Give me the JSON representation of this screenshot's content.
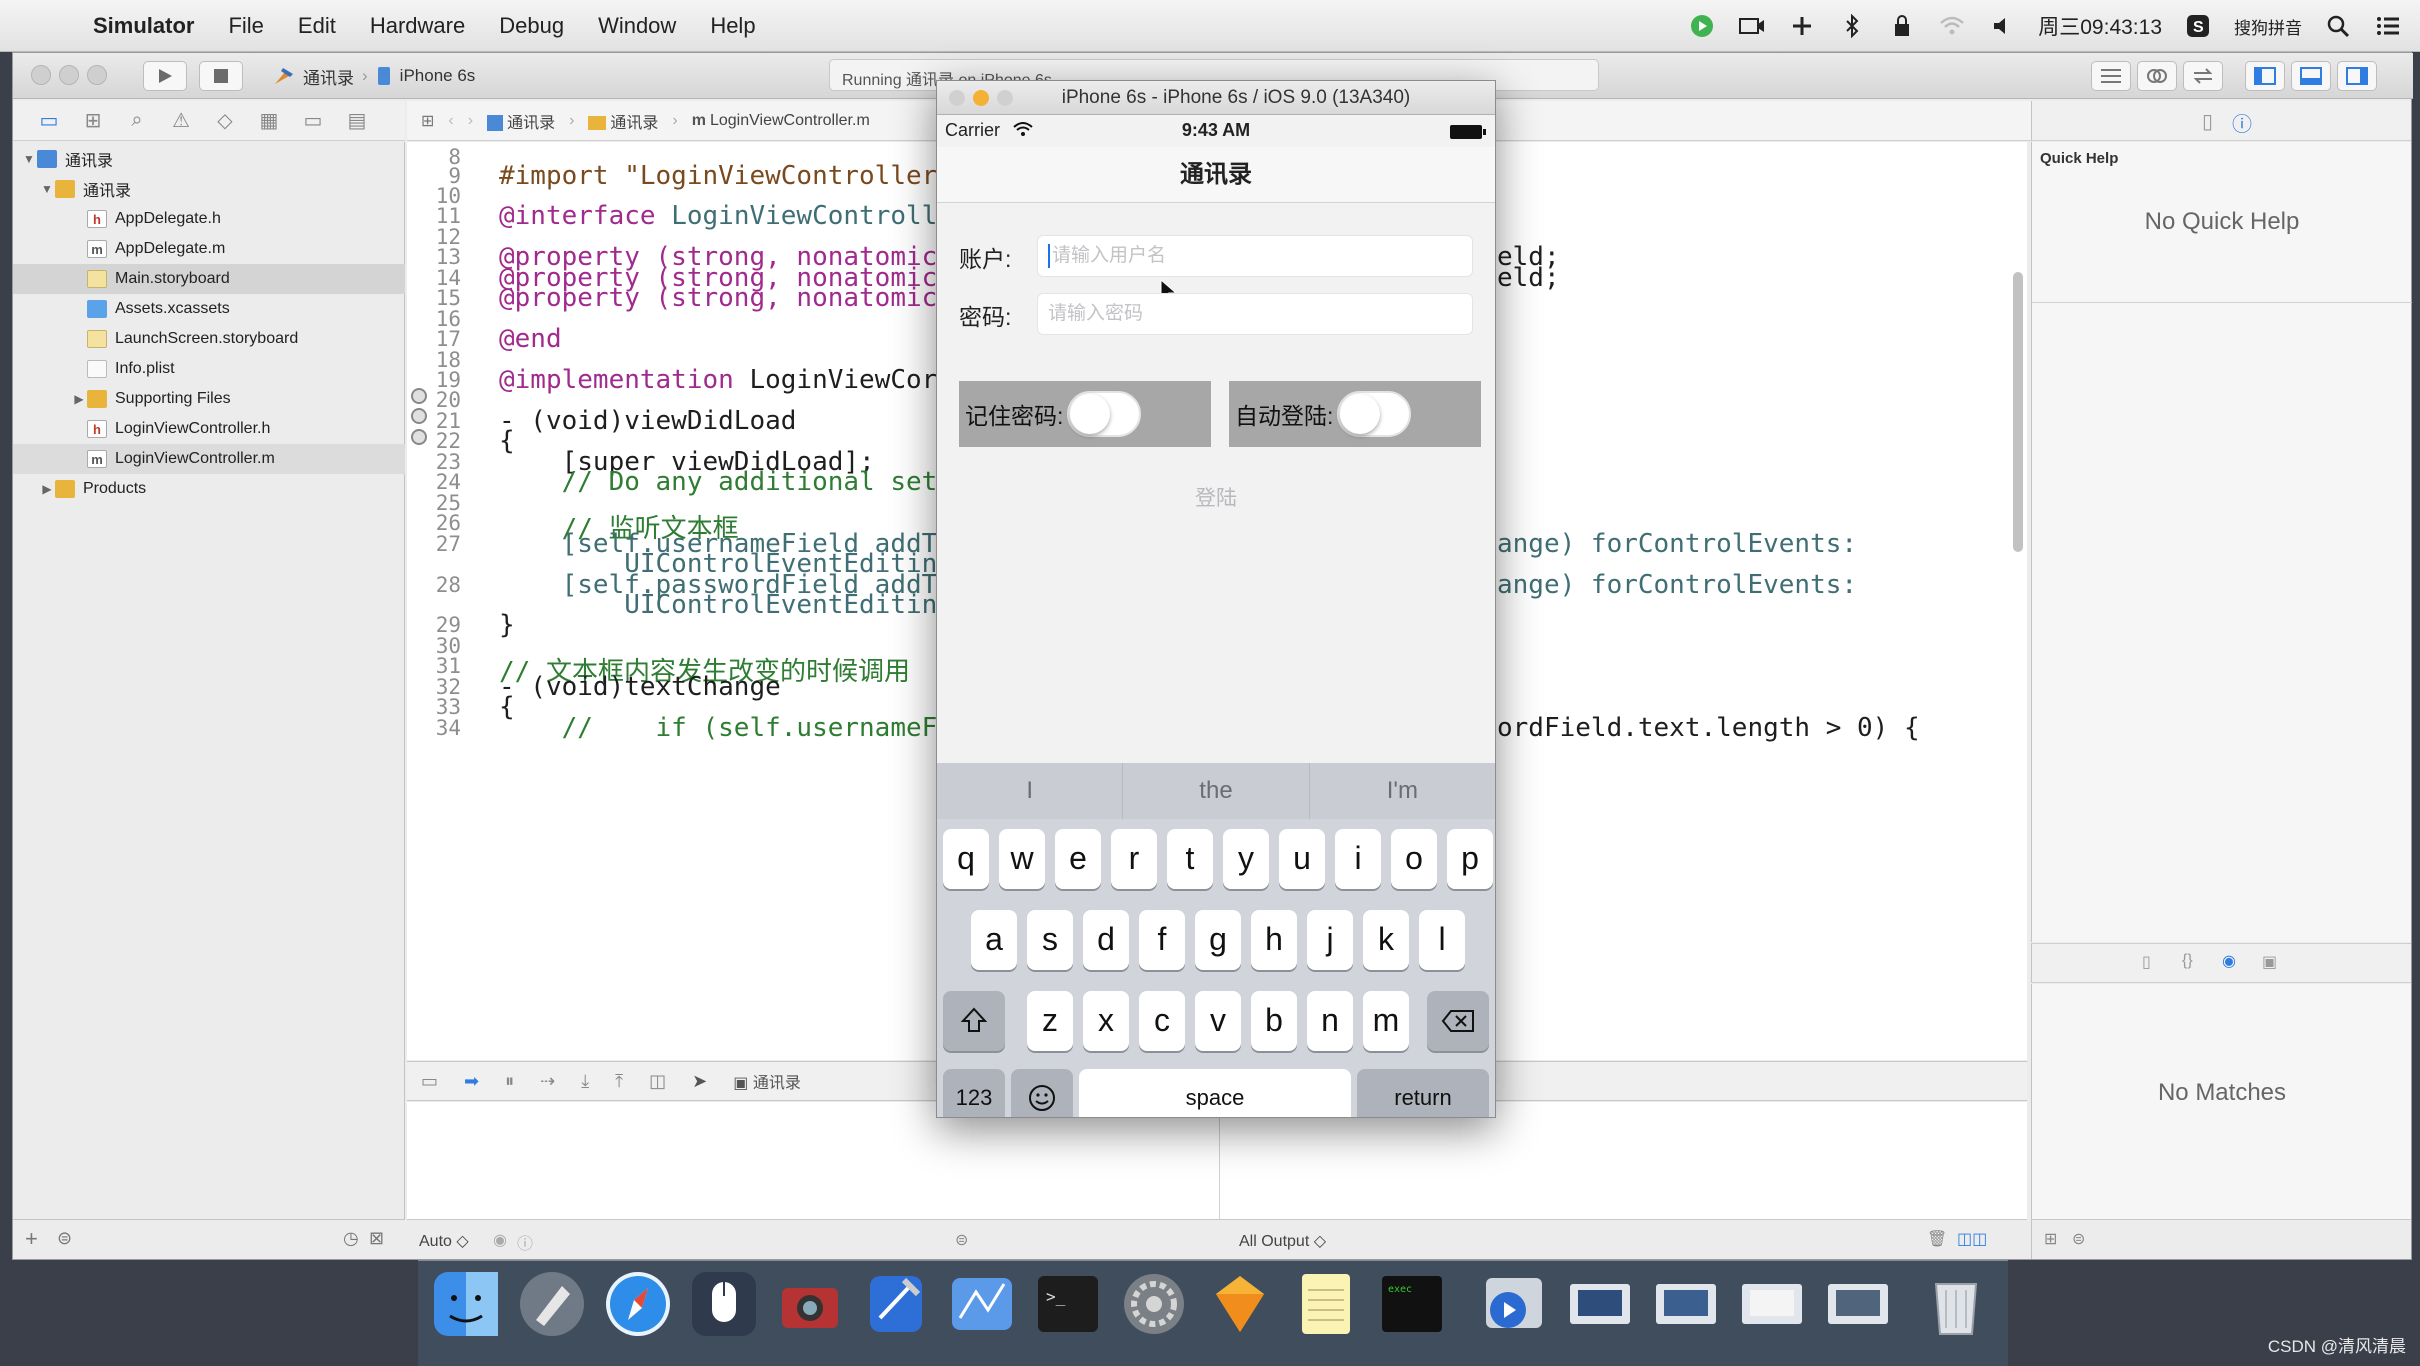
{
  "menubar": {
    "apple": "",
    "items": [
      "Simulator",
      "File",
      "Edit",
      "Hardware",
      "Debug",
      "Window",
      "Help"
    ],
    "clock": "周三09:43:13",
    "ime": "搜狗拼音"
  },
  "toolbar": {
    "scheme_project": "通讯录",
    "scheme_device": "iPhone 6s",
    "activity": "Running 通讯录 on iPhone 6s"
  },
  "navigator": {
    "items": [
      {
        "label": "通讯录",
        "type": "project"
      },
      {
        "label": "通讯录",
        "type": "folder"
      },
      {
        "label": "AppDelegate.h",
        "type": "h"
      },
      {
        "label": "AppDelegate.m",
        "type": "m"
      },
      {
        "label": "Main.storyboard",
        "type": "storyboard"
      },
      {
        "label": "Assets.xcassets",
        "type": "assets"
      },
      {
        "label": "LaunchScreen.storyboard",
        "type": "storyboard"
      },
      {
        "label": "Info.plist",
        "type": "plist"
      },
      {
        "label": "Supporting Files",
        "type": "folder"
      },
      {
        "label": "LoginViewController.h",
        "type": "h"
      },
      {
        "label": "LoginViewController.m",
        "type": "m"
      },
      {
        "label": "Products",
        "type": "folder"
      }
    ]
  },
  "jumpbar": {
    "crumbs": [
      "通讯录",
      "通讯录",
      "LoginViewController.m"
    ]
  },
  "editor": {
    "line_numbers": [
      "8",
      "9",
      "10",
      "11",
      "12",
      "13",
      "14",
      "15",
      "16",
      "17",
      "18",
      "19",
      "20",
      "21",
      "22",
      "23",
      "24",
      "25",
      "26",
      "27",
      "",
      "28",
      "",
      "29",
      "30",
      "31",
      "32",
      "33",
      "34"
    ],
    "lines": {
      "l9": "#import \"LoginViewController",
      "l11a": "@interface",
      "l11b": " LoginViewControll",
      "l13": "@property (strong, nonatomic",
      "l14": "@property (strong, nonatomic",
      "l15": "@property (strong, nonatomic",
      "l17": "@end",
      "l19a": "@implementation",
      "l19b": " LoginViewCor",
      "l21": "- (void)viewDidLoad",
      "l22": "{",
      "l23": "    [super viewDidLoad];",
      "l24": "    // Do any additional set",
      "l26": "    // 监听文本框",
      "l27": "    [self.usernameField addT",
      "l27b": "        UIControlEventEditin",
      "l28": "    [self.passwordField addT",
      "l28b": "        UIControlEventEditin",
      "l29": "}",
      "l31": "// 文本框内容发生改变的时候调用",
      "l32": "- (void)textChange",
      "l33": "{",
      "l34": "    //    if (self.usernameF",
      "r13": "eld;",
      "r14": "eld;",
      "r27": "ange) forControlEvents:",
      "r28": "ange) forControlEvents:",
      "r34": "ordField.text.length > 0) {"
    }
  },
  "debug": {
    "target": "通讯录",
    "auto": "Auto ◇",
    "output": "All Output ◇"
  },
  "utilities": {
    "quick_help_title": "Quick Help",
    "no_quick_help": "No Quick Help",
    "no_matches": "No Matches"
  },
  "simulator": {
    "title": "iPhone 6s - iPhone 6s / iOS 9.0 (13A340)",
    "carrier": "Carrier",
    "time": "9:43 AM",
    "nav_title": "通讯录",
    "account_label": "账户:",
    "account_placeholder": "请输入用户名",
    "password_label": "密码:",
    "password_placeholder": "请输入密码",
    "remember_label": "记住密码:",
    "auto_login_label": "自动登陆:",
    "remember_on": false,
    "auto_login_on": false,
    "login_button": "登陆",
    "keyboard": {
      "predictions": [
        "I",
        "the",
        "I'm"
      ],
      "row1": [
        "q",
        "w",
        "e",
        "r",
        "t",
        "y",
        "u",
        "i",
        "o",
        "p"
      ],
      "row2": [
        "a",
        "s",
        "d",
        "f",
        "g",
        "h",
        "j",
        "k",
        "l"
      ],
      "row3": [
        "z",
        "x",
        "c",
        "v",
        "b",
        "n",
        "m"
      ],
      "numbers": "123",
      "space": "space",
      "return": "return"
    }
  },
  "watermark": "CSDN @清风清晨"
}
